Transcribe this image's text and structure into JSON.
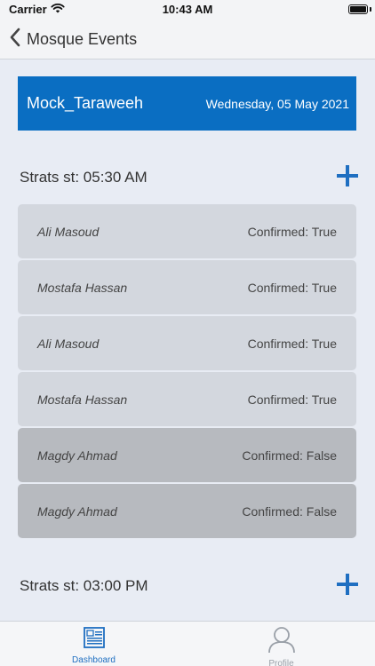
{
  "status_bar": {
    "carrier": "Carrier",
    "time": "10:43 AM"
  },
  "nav": {
    "title": "Mosque Events"
  },
  "event": {
    "name": "Mock_Taraweeh",
    "date": "Wednesday, 05 May 2021"
  },
  "sessions": [
    {
      "label": "Strats st: 05:30 AM",
      "attendees": [
        {
          "name": "Ali Masoud",
          "status": "Confirmed: True"
        },
        {
          "name": "Mostafa Hassan",
          "status": "Confirmed: True"
        },
        {
          "name": "Ali Masoud",
          "status": "Confirmed: True"
        },
        {
          "name": "Mostafa Hassan",
          "status": "Confirmed: True"
        },
        {
          "name": "Magdy Ahmad",
          "status": "Confirmed: False"
        },
        {
          "name": "Magdy Ahmad",
          "status": "Confirmed: False"
        }
      ]
    },
    {
      "label": "Strats st: 03:00 PM",
      "attendees": []
    }
  ],
  "tab_bar": {
    "dashboard_label": "Dashboard",
    "profile_label": "Profile"
  },
  "colors": {
    "accent": "#0a6ec2",
    "tab_active": "#1f6fc1",
    "tab_inactive": "#9aa0a8",
    "row_confirmed": "#d3d7de",
    "row_unconfirmed": "#b7babf"
  }
}
